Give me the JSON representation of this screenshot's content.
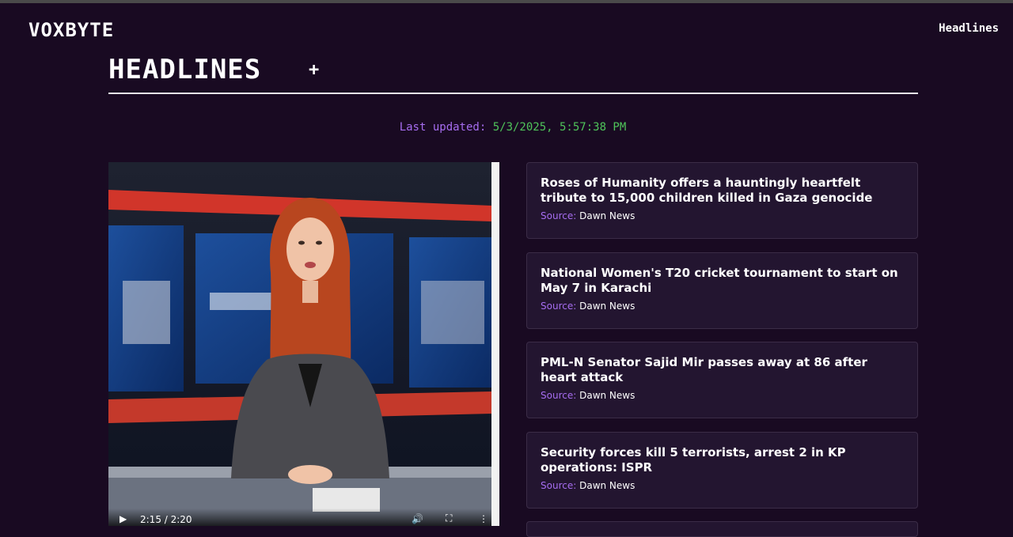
{
  "brand": "VOXBYTE",
  "nav": {
    "headlines": "Headlines"
  },
  "section": {
    "title": "HEADLINES",
    "plus": "+"
  },
  "updated": {
    "label": "Last updated:",
    "value": "5/3/2025, 5:57:38 PM"
  },
  "video": {
    "time": "2:15 / 2:20",
    "progress": 0.964
  },
  "colors": {
    "background": "#190a22",
    "accent": "#a66df0",
    "updated_value": "#4fc45a",
    "card": "#231530"
  },
  "headlines": [
    {
      "title": "Roses of Humanity offers a hauntingly heartfelt tribute to 15,000 children killed in Gaza genocide",
      "source_label": "Source:",
      "source": "Dawn News"
    },
    {
      "title": "National Women's T20 cricket tournament to start on May 7 in Karachi",
      "source_label": "Source:",
      "source": "Dawn News"
    },
    {
      "title": "PML-N Senator Sajid Mir passes away at 86 after heart attack",
      "source_label": "Source:",
      "source": "Dawn News"
    },
    {
      "title": "Security forces kill 5 terrorists, arrest 2 in KP operations: ISPR",
      "source_label": "Source:",
      "source": "Dawn News"
    }
  ]
}
